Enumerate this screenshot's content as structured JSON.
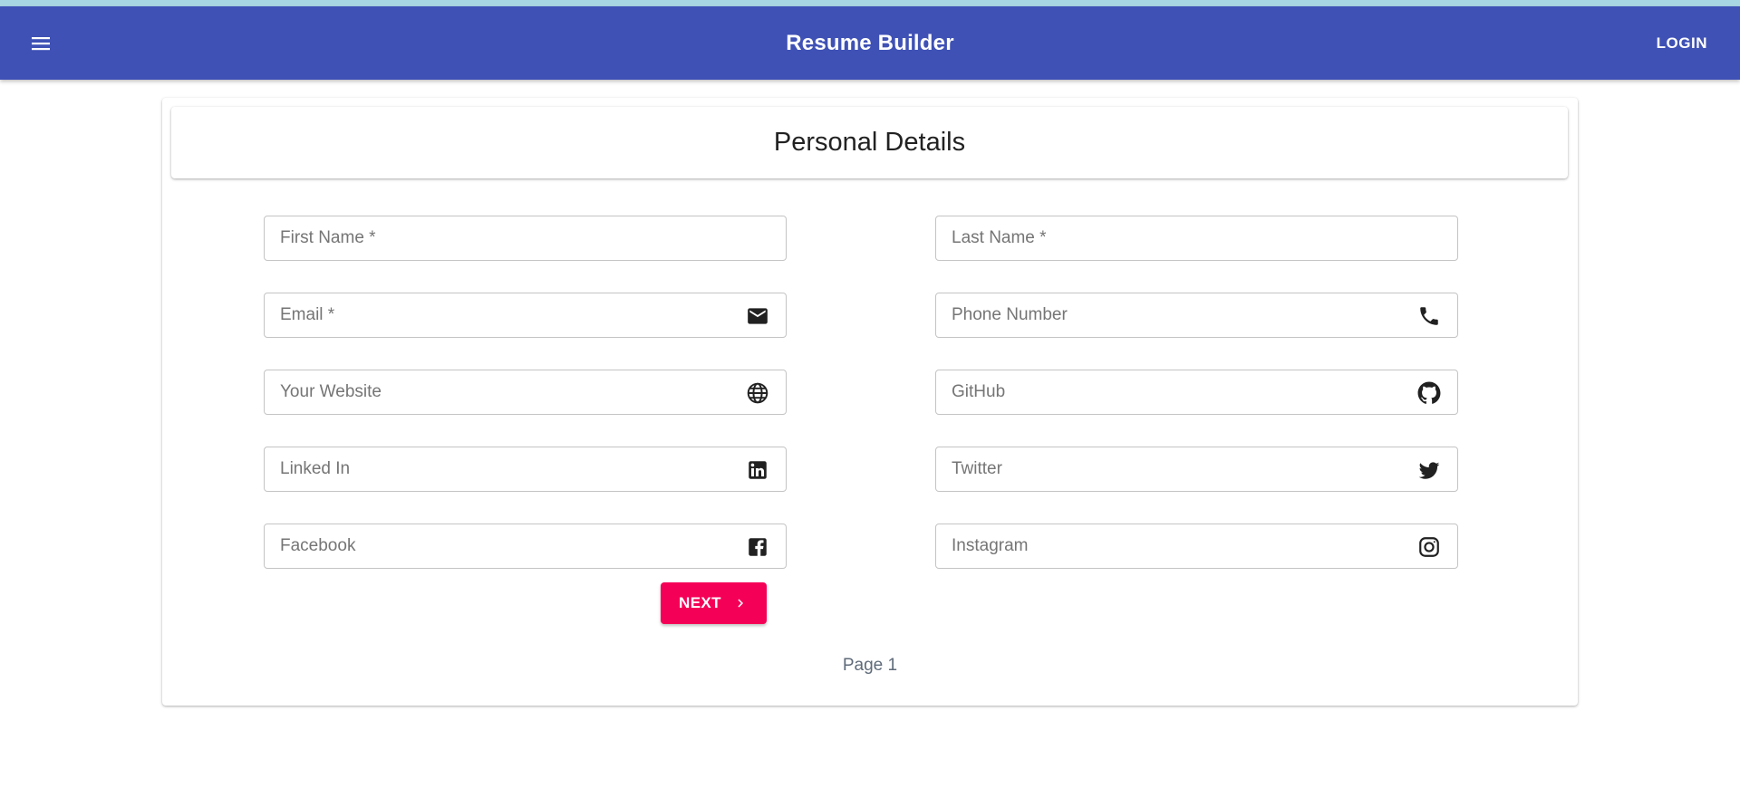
{
  "app": {
    "title": "Resume Builder",
    "login_label": "LOGIN"
  },
  "card": {
    "title": "Personal Details"
  },
  "fields": {
    "first_name": {
      "placeholder": "First Name *"
    },
    "last_name": {
      "placeholder": "Last Name *"
    },
    "email": {
      "placeholder": "Email *",
      "icon": "mail-icon"
    },
    "phone": {
      "placeholder": "Phone Number",
      "icon": "phone-icon"
    },
    "website": {
      "placeholder": "Your Website",
      "icon": "globe-icon"
    },
    "github": {
      "placeholder": "GitHub",
      "icon": "github-icon"
    },
    "linkedin": {
      "placeholder": "Linked In",
      "icon": "linkedin-icon"
    },
    "twitter": {
      "placeholder": "Twitter",
      "icon": "twitter-icon"
    },
    "facebook": {
      "placeholder": "Facebook",
      "icon": "facebook-icon"
    },
    "instagram": {
      "placeholder": "Instagram",
      "icon": "instagram-icon"
    }
  },
  "actions": {
    "next_label": "NEXT"
  },
  "pagination": {
    "page_label": "Page 1"
  },
  "colors": {
    "appbar": "#3f51b5",
    "accent": "#f50057",
    "top_strip": "#a9d6e3"
  }
}
